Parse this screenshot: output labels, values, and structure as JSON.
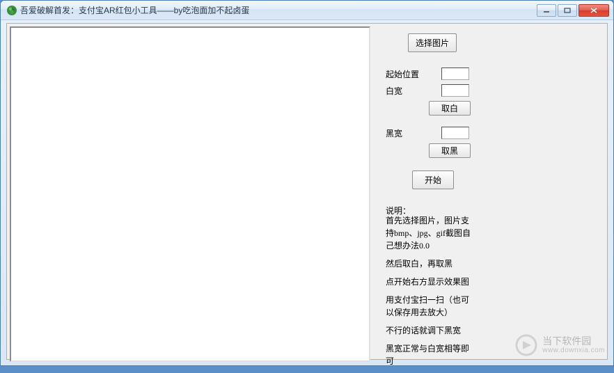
{
  "window": {
    "title": "吾爱破解首发：支付宝AR红包小工具——by吃泡面加不起卤蛋"
  },
  "controls": {
    "select_image": "选择图片",
    "start_pos_label": "起始位置",
    "white_width_label": "白宽",
    "take_white": "取白",
    "black_width_label": "黑宽",
    "take_black": "取黑",
    "start": "开始",
    "start_pos_value": "",
    "white_width_value": "",
    "black_width_value": ""
  },
  "description": {
    "heading": "说明：",
    "line1": "首先选择图片，图片支持bmp、jpg、gif截图自己想办法0.0",
    "line2": "然后取白，再取黑",
    "line3": "点开始右方显示效果图",
    "line4": "用支付宝扫一扫（也可以保存用去放大）",
    "line5": "不行的话就调下黑宽",
    "line6": "黑宽正常与白宽相等即可"
  },
  "watermark": {
    "name": "当下软件园",
    "url": "www.downxia.com"
  }
}
